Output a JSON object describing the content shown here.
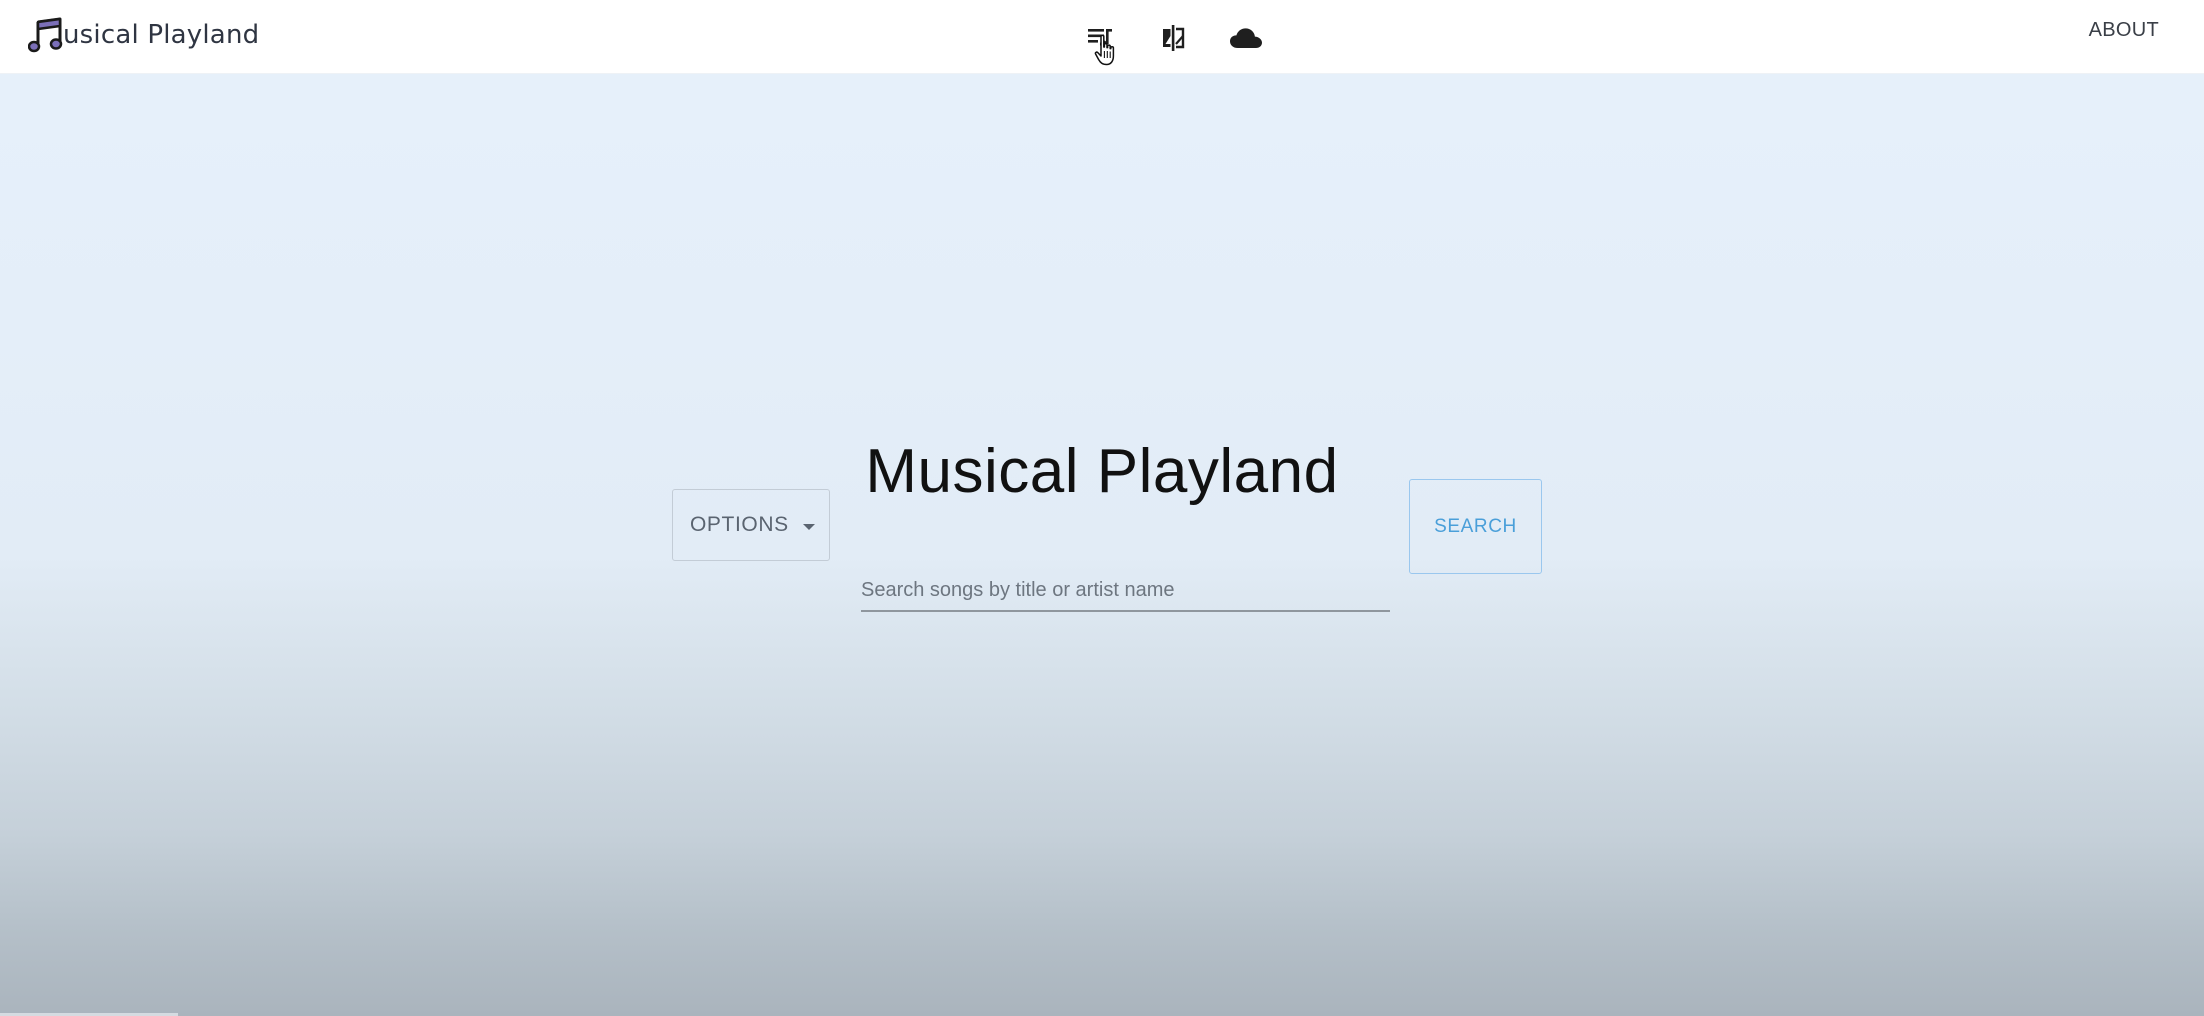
{
  "navbar": {
    "brand_text": "usical Playland",
    "brand_logo_icon": "music-note-icon",
    "icons": [
      "playlist-icon",
      "compare-icon",
      "cloud-icon"
    ],
    "about_label": "ABOUT"
  },
  "hero": {
    "title": "Musical Playland",
    "options_label": "OPTIONS",
    "search_placeholder": "Search songs by title or artist name",
    "search_value": "",
    "search_button_label": "SEARCH"
  },
  "colors": {
    "logo_purple": "#7b6fb8",
    "search_button_blue": "#4a9fd9",
    "hero_top": "#e6f0fa",
    "hero_bottom": "#aab4bd"
  }
}
